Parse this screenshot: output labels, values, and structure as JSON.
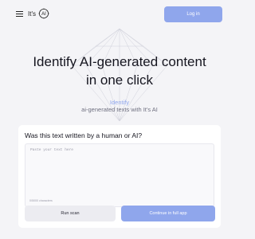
{
  "header": {
    "logo_text": "It's",
    "logo_badge": "AI",
    "login_label": "Log in"
  },
  "hero": {
    "title_line1": "Identify AI-generated content",
    "title_line2": "in one click",
    "subtitle_accent": "Identify",
    "subtitle_text": "ai-generated texts with It's AI"
  },
  "card": {
    "question": "Was this text written by a human or AI?",
    "input_placeholder": "Paste your text here",
    "char_count": "0/5000 characters",
    "run_label": "Run scan",
    "full_label": "Continue in full app"
  },
  "colors": {
    "accent": "#8fa6ec",
    "background": "#f4f4f7",
    "card": "#ffffff",
    "secondary_button": "#ececf1"
  },
  "icons": {
    "menu": "hamburger-menu-icon",
    "logo": "ai-circle-logo-icon"
  }
}
